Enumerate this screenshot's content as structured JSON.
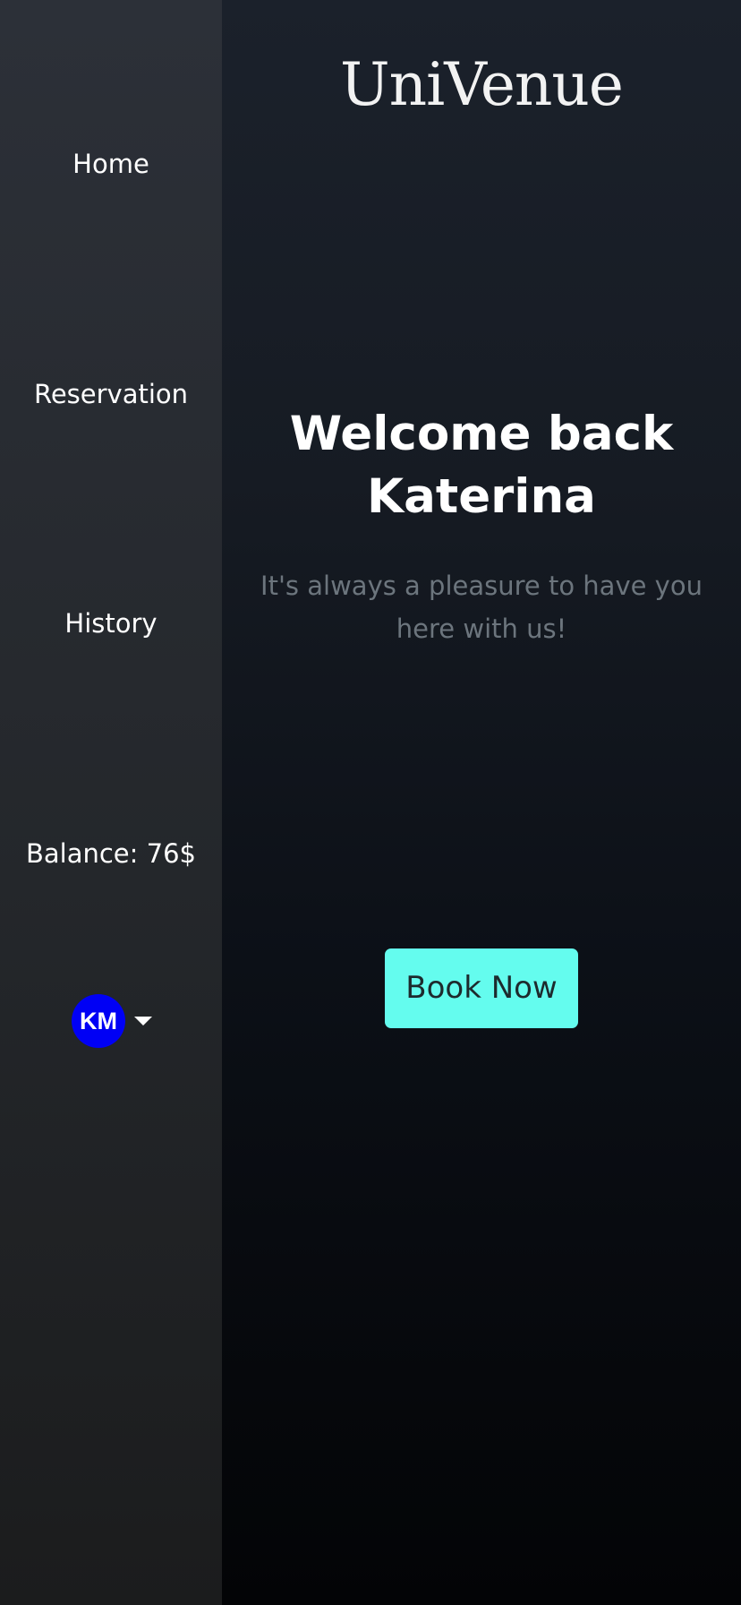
{
  "sidebar": {
    "items": [
      {
        "label": "Home"
      },
      {
        "label": "Reservation"
      },
      {
        "label": "History"
      }
    ],
    "balance_label": "Balance: 76$",
    "user": {
      "initials": "KM",
      "avatar_color": "#0000f5",
      "menu_icon": "caret-down-icon"
    }
  },
  "main": {
    "logo": "UniVenue",
    "welcome_line1": "Welcome back",
    "welcome_line2": "Katerina",
    "subtitle": "It's always a pleasure to have you here with us!",
    "cta_label": "Book Now",
    "cta_color": "#64fcee"
  }
}
